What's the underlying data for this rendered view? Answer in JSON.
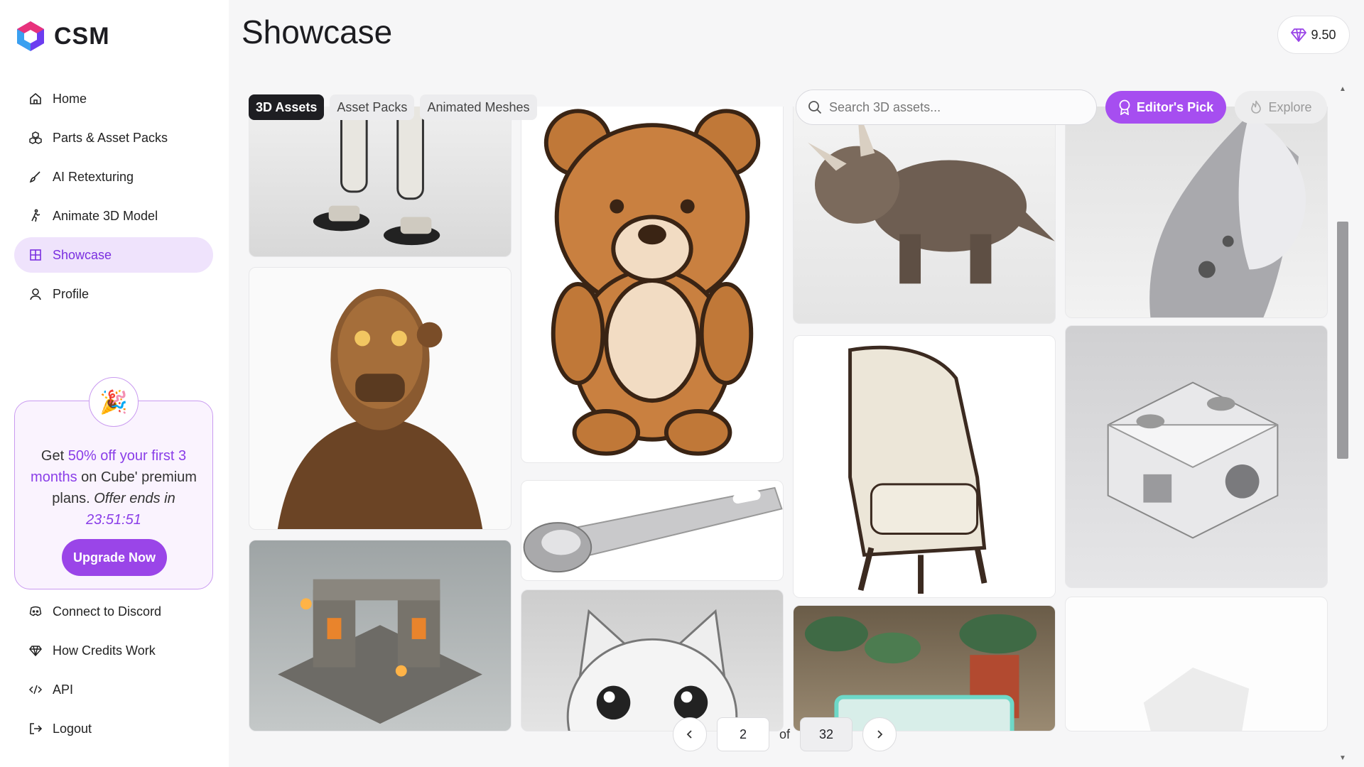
{
  "app": {
    "logo_text": "CSM"
  },
  "sidebar": {
    "items": [
      {
        "label": "Home",
        "icon": "home-icon"
      },
      {
        "label": "Parts & Asset Packs",
        "icon": "cubes-icon"
      },
      {
        "label": "AI Retexturing",
        "icon": "brush-icon"
      },
      {
        "label": "Animate 3D Model",
        "icon": "running-figure-icon"
      },
      {
        "label": "Showcase",
        "icon": "grid-icon",
        "active": true
      },
      {
        "label": "Profile",
        "icon": "user-icon"
      }
    ],
    "bottom_items": [
      {
        "label": "Connect to Discord",
        "icon": "discord-icon"
      },
      {
        "label": "How Credits Work",
        "icon": "diamond-icon"
      },
      {
        "label": "API",
        "icon": "code-icon"
      },
      {
        "label": "Logout",
        "icon": "logout-icon"
      }
    ]
  },
  "promo": {
    "text_get": "Get ",
    "text_highlight": "50% off your first 3 months",
    "text_mid": " on Cube' premium plans. ",
    "text_offer": "Offer ends in ",
    "countdown": "23:51:51",
    "button_label": "Upgrade Now"
  },
  "header": {
    "title": "Showcase",
    "credits": "9.50"
  },
  "tabs": [
    {
      "label": "3D Assets",
      "active": true
    },
    {
      "label": "Asset Packs",
      "active": false
    },
    {
      "label": "Animated Meshes",
      "active": false
    }
  ],
  "search": {
    "placeholder": "Search 3D assets..."
  },
  "toolbar": {
    "editors_pick_label": "Editor's Pick",
    "explore_label": "Explore"
  },
  "pagination": {
    "current": "2",
    "of_label": "of",
    "total": "32"
  },
  "colors": {
    "accent": "#a64ef0",
    "active_nav_bg": "#efe3fc",
    "active_nav_text": "#7a2fe0"
  }
}
